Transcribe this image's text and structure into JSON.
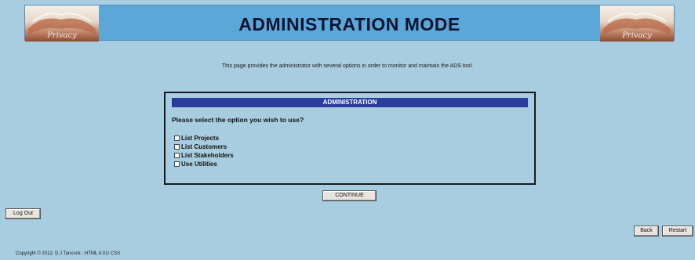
{
  "banner": {
    "title": "ADMINISTRATION MODE",
    "logo_text_left": "Privacy",
    "logo_text_right": "Privacy"
  },
  "intro_text": "This page provides the administrator with several options in order to monitor and maintain the ADS tool.",
  "admin": {
    "header": "ADMINISTRATION",
    "prompt": "Please select the option you wish to use?",
    "options": [
      {
        "label": "List Projects",
        "checked": false
      },
      {
        "label": "List Customers",
        "checked": false
      },
      {
        "label": "List Stakeholders",
        "checked": false
      },
      {
        "label": "Use Utilities",
        "checked": false
      }
    ]
  },
  "buttons": {
    "continue": "CONTINUE",
    "logout": "Log Out",
    "back": "Back",
    "restart": "Restart"
  },
  "footer": {
    "copyright": "Copyright © 2012, D J Tancock - HTML 4.01/ CSS"
  },
  "colors": {
    "page_bg": "#a9cde0",
    "banner_bg": "#5aa7d8",
    "header_bar": "#2a3d9e"
  }
}
